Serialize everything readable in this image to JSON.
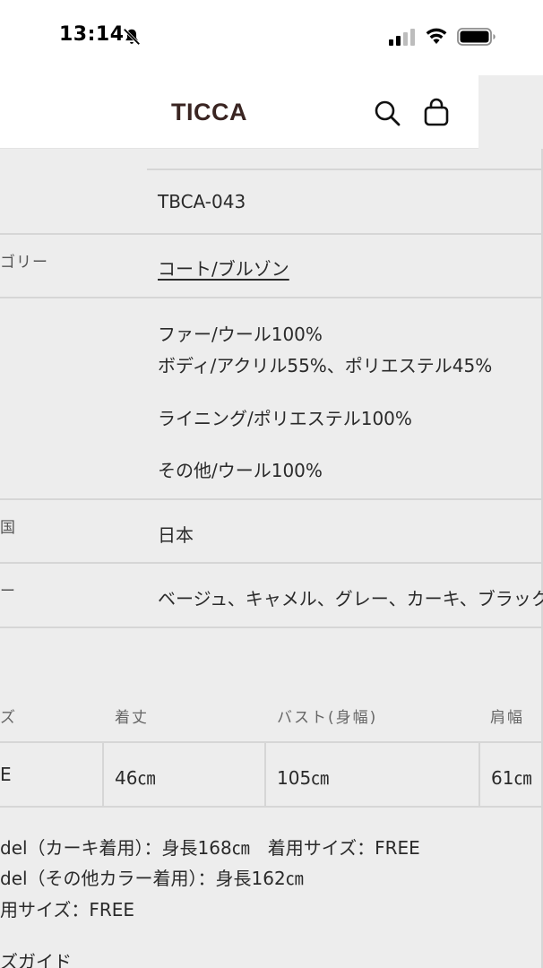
{
  "status_bar": {
    "time": "13:14"
  },
  "header": {
    "logo": "TICCA"
  },
  "specs": {
    "product_code": "TBCA-043",
    "category_label": "ゴリー",
    "category_value": "コート/ブルゾン",
    "material_lines": [
      "ファー/ウール100%",
      "ボディ/アクリル55%、ポリエステル45%",
      "ライニング/ポリエステル100%",
      "その他/ウール100%"
    ],
    "origin_label": "国",
    "origin_value": "日本",
    "color_label": "ー",
    "color_value": "ベージュ、キャメル、グレー、カーキ、ブラック"
  },
  "size_table": {
    "headers": [
      "ズ",
      "着丈",
      "バスト(身幅)",
      "肩幅"
    ],
    "row": [
      "E",
      "46㎝",
      "105㎝",
      "61㎝"
    ]
  },
  "model_info": {
    "line1": "del（カーキ着用）：身長168㎝　着用サイズ：FREE",
    "line2": "del（その他カラー着用）：身長162㎝",
    "line3": "用サイズ：FREE",
    "size_guide": "ズガイド"
  }
}
